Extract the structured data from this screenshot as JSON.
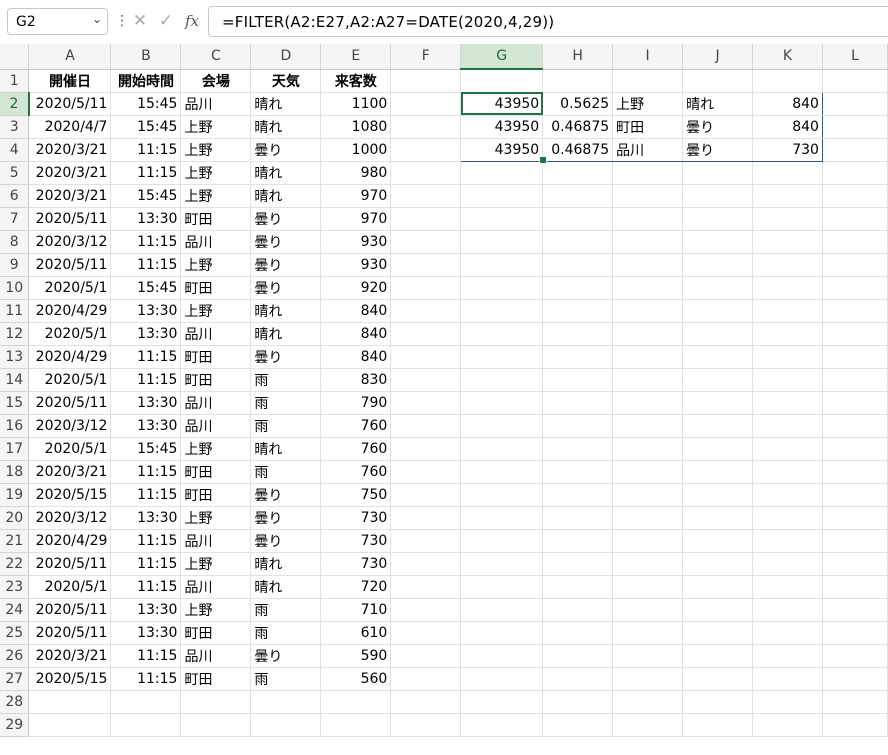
{
  "namebox": {
    "value": "G2",
    "chevron_icon": "chevron-down-icon"
  },
  "formula_bar": {
    "more_icon": "⋮",
    "cancel_icon": "✕",
    "enter_icon": "✓",
    "fx_icon": "fx",
    "formula": "=FILTER(A2:E27,A2:A27=DATE(2020,4,29))"
  },
  "columns": [
    "A",
    "B",
    "C",
    "D",
    "E",
    "F",
    "G",
    "H",
    "I",
    "J",
    "K",
    "L"
  ],
  "selected_column": "G",
  "selected_row": 2,
  "headers": [
    "開催日",
    "開始時間",
    "会場",
    "天気",
    "来客数"
  ],
  "rows": [
    [
      "2020/5/11",
      "15:45",
      "品川",
      "晴れ",
      "1100"
    ],
    [
      "2020/4/7",
      "15:45",
      "上野",
      "晴れ",
      "1080"
    ],
    [
      "2020/3/21",
      "11:15",
      "上野",
      "曇り",
      "1000"
    ],
    [
      "2020/3/21",
      "11:15",
      "上野",
      "晴れ",
      "980"
    ],
    [
      "2020/3/21",
      "15:45",
      "上野",
      "晴れ",
      "970"
    ],
    [
      "2020/5/11",
      "13:30",
      "町田",
      "曇り",
      "970"
    ],
    [
      "2020/3/12",
      "11:15",
      "品川",
      "曇り",
      "930"
    ],
    [
      "2020/5/11",
      "11:15",
      "上野",
      "曇り",
      "930"
    ],
    [
      "2020/5/1",
      "15:45",
      "町田",
      "曇り",
      "920"
    ],
    [
      "2020/4/29",
      "13:30",
      "上野",
      "晴れ",
      "840"
    ],
    [
      "2020/5/1",
      "13:30",
      "品川",
      "晴れ",
      "840"
    ],
    [
      "2020/4/29",
      "11:15",
      "町田",
      "曇り",
      "840"
    ],
    [
      "2020/5/1",
      "11:15",
      "町田",
      "雨",
      "830"
    ],
    [
      "2020/5/11",
      "13:30",
      "品川",
      "雨",
      "790"
    ],
    [
      "2020/3/12",
      "13:30",
      "品川",
      "雨",
      "760"
    ],
    [
      "2020/5/1",
      "15:45",
      "上野",
      "晴れ",
      "760"
    ],
    [
      "2020/3/21",
      "11:15",
      "町田",
      "雨",
      "760"
    ],
    [
      "2020/5/15",
      "11:15",
      "町田",
      "曇り",
      "750"
    ],
    [
      "2020/3/12",
      "13:30",
      "上野",
      "曇り",
      "730"
    ],
    [
      "2020/4/29",
      "11:15",
      "品川",
      "曇り",
      "730"
    ],
    [
      "2020/5/11",
      "11:15",
      "上野",
      "晴れ",
      "730"
    ],
    [
      "2020/5/1",
      "11:15",
      "品川",
      "晴れ",
      "720"
    ],
    [
      "2020/5/11",
      "13:30",
      "上野",
      "雨",
      "710"
    ],
    [
      "2020/5/11",
      "13:30",
      "町田",
      "雨",
      "610"
    ],
    [
      "2020/3/21",
      "11:15",
      "品川",
      "曇り",
      "590"
    ],
    [
      "2020/5/15",
      "11:15",
      "町田",
      "雨",
      "560"
    ]
  ],
  "spill": [
    [
      "43950",
      "0.5625",
      "上野",
      "晴れ",
      "840"
    ],
    [
      "43950",
      "0.46875",
      "町田",
      "曇り",
      "840"
    ],
    [
      "43950",
      "0.46875",
      "品川",
      "曇り",
      "730"
    ]
  ],
  "colors": {
    "accent": "#217346",
    "spill_border": "#2f5597",
    "grid": "#e1e1e1"
  }
}
